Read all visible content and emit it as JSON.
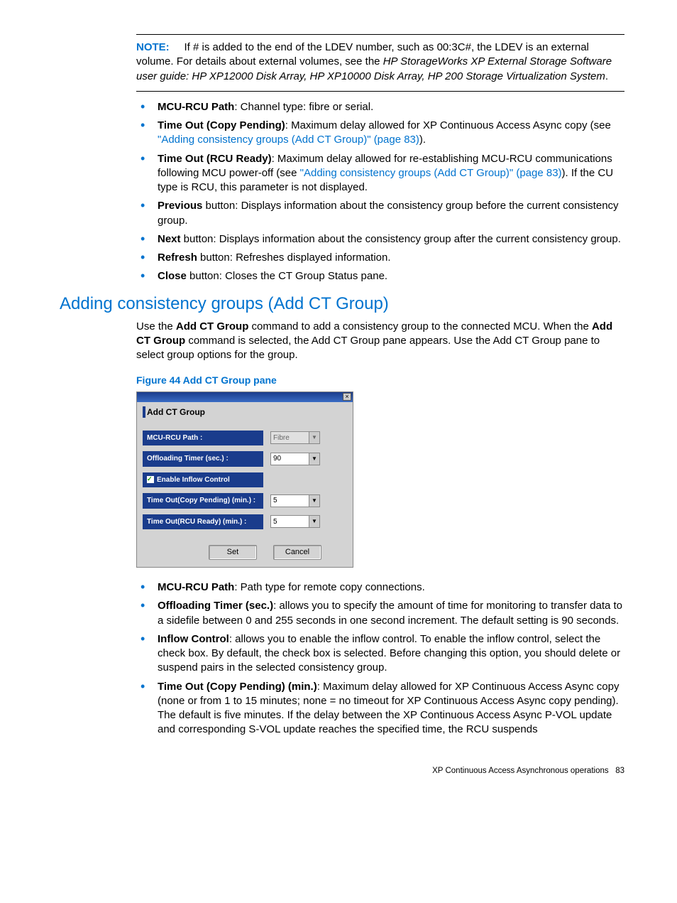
{
  "note": {
    "label": "NOTE:",
    "text_before_italic": "If # is added to the end of the LDEV number, such as 00:3C#, the LDEV is an external volume. For details about external volumes, see the ",
    "italic": "HP StorageWorks XP External Storage Software user guide: HP XP12000 Disk Array, HP XP10000 Disk Array, HP 200 Storage Virtualization System",
    "after": "."
  },
  "top_list": {
    "mcu_path": {
      "bold": "MCU-RCU Path",
      "rest": ": Channel type: fibre or serial."
    },
    "time_pending": {
      "bold": "Time Out (Copy Pending)",
      "rest1": ": Maximum delay allowed for XP Continuous Access Async copy (see ",
      "link": "\"Adding consistency groups (Add CT Group)\" (page 83)",
      "rest2": ")."
    },
    "time_ready": {
      "bold": "Time Out (RCU Ready)",
      "rest1": ": Maximum delay allowed for re-establishing MCU-RCU communications following MCU power-off (see ",
      "link": "\"Adding consistency groups (Add CT Group)\" (page 83)",
      "rest2": "). If the CU type is RCU, this parameter is not displayed."
    },
    "previous": {
      "bold": "Previous",
      "rest": " button: Displays information about the consistency group before the current consistency group."
    },
    "next": {
      "bold": "Next",
      "rest": " button: Displays information about the consistency group after the current consistency group."
    },
    "refresh": {
      "bold": "Refresh",
      "rest": " button: Refreshes displayed information."
    },
    "close": {
      "bold": "Close",
      "rest": " button: Closes the CT Group Status pane."
    }
  },
  "section_heading": "Adding consistency groups (Add CT Group)",
  "section_intro": {
    "t1": "Use the ",
    "b1": "Add CT Group",
    "t2": " command to add a consistency group to the connected MCU. When the ",
    "b2": "Add CT Group",
    "t3": " command is selected, the Add CT Group pane appears. Use the Add CT Group pane to select group options for the group."
  },
  "figure_caption": "Figure 44 Add CT Group pane",
  "dialog": {
    "title": "Add CT Group",
    "close_x": "×",
    "rows": {
      "mcu": {
        "label": "MCU-RCU Path :",
        "value": "Fibre",
        "disabled": true
      },
      "off": {
        "label": "Offloading Timer (sec.) :",
        "value": "90"
      },
      "inflow": {
        "label": "Enable Inflow Control"
      },
      "pend": {
        "label": "Time Out(Copy Pending) (min.) :",
        "value": "5"
      },
      "ready": {
        "label": "Time Out(RCU Ready) (min.) :",
        "value": "5"
      }
    },
    "buttons": {
      "set": "Set",
      "cancel": "Cancel"
    }
  },
  "bottom_list": {
    "mcu": {
      "bold": "MCU-RCU Path",
      "rest": ": Path type for remote copy connections."
    },
    "off": {
      "bold": "Offloading Timer (sec.)",
      "rest": ": allows you to specify the amount of time for monitoring to transfer data to a sidefile between 0 and 255 seconds in one second increment. The default setting is 90 seconds."
    },
    "inflow": {
      "bold": "Inflow Control",
      "rest": ": allows you to enable the inflow control. To enable the inflow control, select the check box. By default, the check box is selected. Before changing this option, you should delete or suspend pairs in the selected consistency group."
    },
    "pend": {
      "bold": "Time Out (Copy Pending) (min.)",
      "rest": ": Maximum delay allowed for XP Continuous Access Async copy (none or from 1 to 15 minutes; none = no timeout for XP Continuous Access Async copy pending). The default is five minutes. If the delay between the XP Continuous Access Async P-VOL update and corresponding S-VOL update reaches the specified time, the RCU suspends"
    }
  },
  "footer": {
    "text": "XP Continuous Access Asynchronous operations",
    "page": "83"
  }
}
